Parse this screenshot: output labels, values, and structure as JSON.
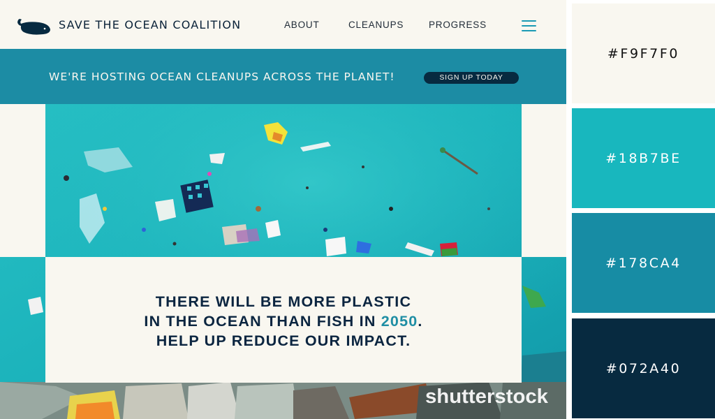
{
  "site": {
    "brand": "SAVE THE OCEAN COALITION",
    "nav": {
      "about": "ABOUT",
      "cleanups": "CLEANUPS",
      "progress": "PROGRESS"
    },
    "banner": {
      "text": "WE'RE HOSTING OCEAN CLEANUPS ACROSS THE PLANET!",
      "signup": "SIGN UP TODAY"
    },
    "stat": {
      "line1": "THERE WILL BE MORE PLASTIC",
      "line2_before": "IN THE OCEAN THAN FISH IN ",
      "line2_year": "2050",
      "line2_after": ".",
      "line3": "HELP UP REDUCE OUR IMPACT."
    },
    "watermark": "shutterstock"
  },
  "palette": [
    {
      "hex": "#F9F7F0",
      "label": "#F9F7F0",
      "text_color": "#111111"
    },
    {
      "hex": "#18B7BE",
      "label": "#18B7BE",
      "text_color": "#ffffff"
    },
    {
      "hex": "#178CA4",
      "label": "#178CA4",
      "text_color": "#ffffff"
    },
    {
      "hex": "#072A40",
      "label": "#072A40",
      "text_color": "#ffffff"
    }
  ]
}
